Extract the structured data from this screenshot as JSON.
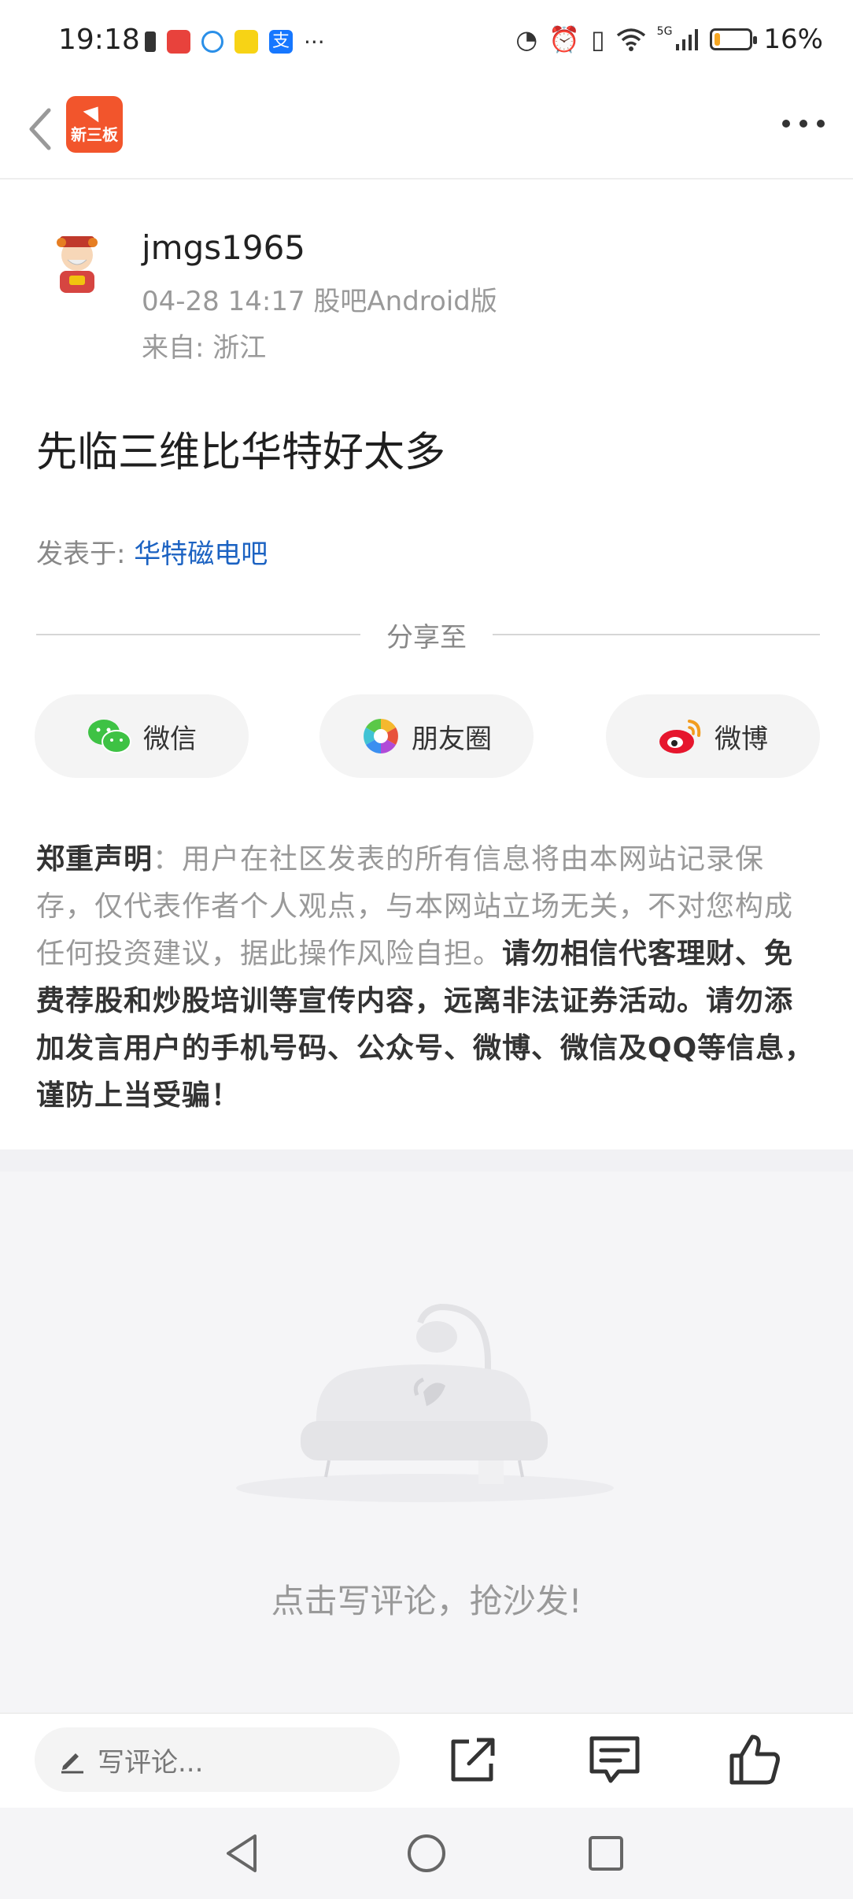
{
  "status_bar": {
    "time": "19:18",
    "battery_percent": "16%",
    "network": "5G",
    "battery_level": 0.16,
    "icons": [
      "battery-saver-icon",
      "app-icon",
      "chat-icon",
      "mail-icon",
      "alipay-icon",
      "more-dots-icon",
      "nfc-icon",
      "alarm-icon",
      "vibrate-icon",
      "wifi-icon",
      "signal-icon",
      "battery-icon"
    ]
  },
  "header": {
    "logo_text": "新三板",
    "back_icon": "back-chevron-icon",
    "more_icon": "more-dots-icon"
  },
  "post": {
    "author": "jmgs1965",
    "meta_time_client": "04-28 14:17 股吧Android版",
    "meta_location": "来自: 浙江",
    "title": "先临三维比华特好太多",
    "posted_in_label": "发表于:",
    "posted_in_board": "华特磁电吧"
  },
  "share": {
    "label": "分享至",
    "buttons": [
      {
        "label": "微信",
        "icon": "wechat-icon"
      },
      {
        "label": "朋友圈",
        "icon": "moments-icon"
      },
      {
        "label": "微博",
        "icon": "weibo-icon"
      }
    ]
  },
  "disclaimer": {
    "heading": "郑重声明",
    "colon": "：",
    "normal": "用户在社区发表的所有信息将由本网站记录保存，仅代表作者个人观点，与本网站立场无关，不对您构成任何投资建议，据此操作风险自担。",
    "bold": "请勿相信代客理财、免费荐股和炒股培训等宣传内容，远离非法证券活动。请勿添加发言用户的手机号码、公众号、微博、微信及QQ等信息，谨防上当受骗！"
  },
  "comments": {
    "empty_text": "点击写评论，抢沙发!"
  },
  "bottom_bar": {
    "comment_placeholder": "写评论...",
    "actions": [
      "share-icon",
      "comment-icon",
      "like-icon"
    ]
  },
  "nav_bar": {
    "buttons": [
      "nav-back-icon",
      "nav-home-icon",
      "nav-recents-icon"
    ]
  }
}
